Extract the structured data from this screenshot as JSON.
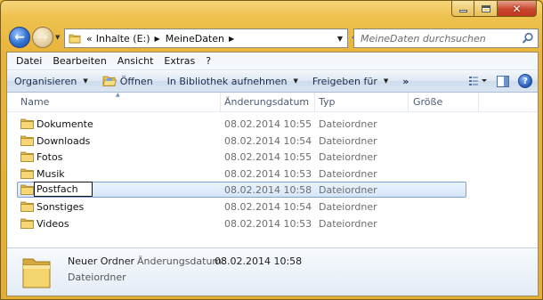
{
  "window": {
    "caption_buttons": [
      "minimize",
      "maximize",
      "close"
    ],
    "frame_color": "#e9b73a"
  },
  "address": {
    "overflow": "«",
    "crumbs": [
      "Inhalte (E:)",
      "MeineDaten"
    ]
  },
  "search": {
    "placeholder": "MeineDaten durchsuchen"
  },
  "menubar": {
    "items": [
      "Datei",
      "Bearbeiten",
      "Ansicht",
      "Extras",
      "?"
    ]
  },
  "toolbar": {
    "organize": "Organisieren",
    "open": "Öffnen",
    "library": "In Bibliothek aufnehmen",
    "share": "Freigeben für",
    "more": "»"
  },
  "columns": {
    "name": "Name",
    "date": "Änderungsdatum",
    "type": "Typ",
    "size": "Größe"
  },
  "files": [
    {
      "name": "Dokumente",
      "date": "08.02.2014 10:55",
      "type": "Dateiordner"
    },
    {
      "name": "Downloads",
      "date": "08.02.2014 10:54",
      "type": "Dateiordner"
    },
    {
      "name": "Fotos",
      "date": "08.02.2014 10:55",
      "type": "Dateiordner"
    },
    {
      "name": "Musik",
      "date": "08.02.2014 10:53",
      "type": "Dateiordner"
    },
    {
      "name": "Postfach",
      "date": "08.02.2014 10:58",
      "type": "Dateiordner",
      "selected": true,
      "renaming": true
    },
    {
      "name": "Sonstiges",
      "date": "08.02.2014 10:54",
      "type": "Dateiordner"
    },
    {
      "name": "Videos",
      "date": "08.02.2014 10:53",
      "type": "Dateiordner"
    }
  ],
  "details": {
    "name": "Neuer Ordner",
    "date_label": "Änderungsdatum:",
    "date_value": "08.02.2014 10:58",
    "type": "Dateiordner"
  },
  "icons": {
    "folder": "folder-icon",
    "back": "back-arrow-icon",
    "forward": "forward-arrow-icon",
    "refresh": "refresh-icon",
    "search": "search-icon",
    "views": "view-options-icon",
    "preview": "preview-pane-icon",
    "help": "help-icon"
  }
}
